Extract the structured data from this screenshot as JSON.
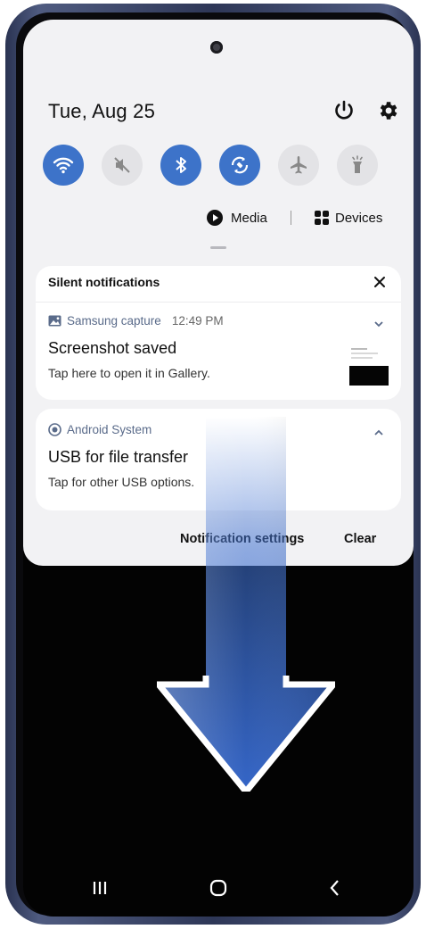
{
  "status": {
    "date": "Tue, Aug 25"
  },
  "quick_toggles": [
    {
      "name": "wifi-icon",
      "state": "on"
    },
    {
      "name": "mute-icon",
      "state": "off"
    },
    {
      "name": "bluetooth-icon",
      "state": "on"
    },
    {
      "name": "auto-rotate-icon",
      "state": "on"
    },
    {
      "name": "airplane-mode-icon",
      "state": "off"
    },
    {
      "name": "flashlight-icon",
      "state": "off"
    }
  ],
  "media_label": "Media",
  "devices_label": "Devices",
  "silent": {
    "title": "Silent notifications"
  },
  "notifications": [
    {
      "app": "Samsung capture",
      "time": "12:49 PM",
      "title": "Screenshot saved",
      "text": "Tap here to open it in Gallery.",
      "icon": "gallery-icon",
      "expand": "chevron-down-icon"
    },
    {
      "app": "Android System",
      "title": "USB for file transfer",
      "text": "Tap for other USB options.",
      "icon": "android-system-icon",
      "expand": "chevron-up-icon"
    }
  ],
  "footer": {
    "settings_label": "Notification settings",
    "clear_label": "Clear"
  },
  "colors": {
    "accent": "#3d73c9",
    "panel": "#f2f2f4",
    "arrow": "#3d6fd0"
  },
  "nav": [
    "recent-apps-icon",
    "home-icon",
    "back-icon"
  ]
}
